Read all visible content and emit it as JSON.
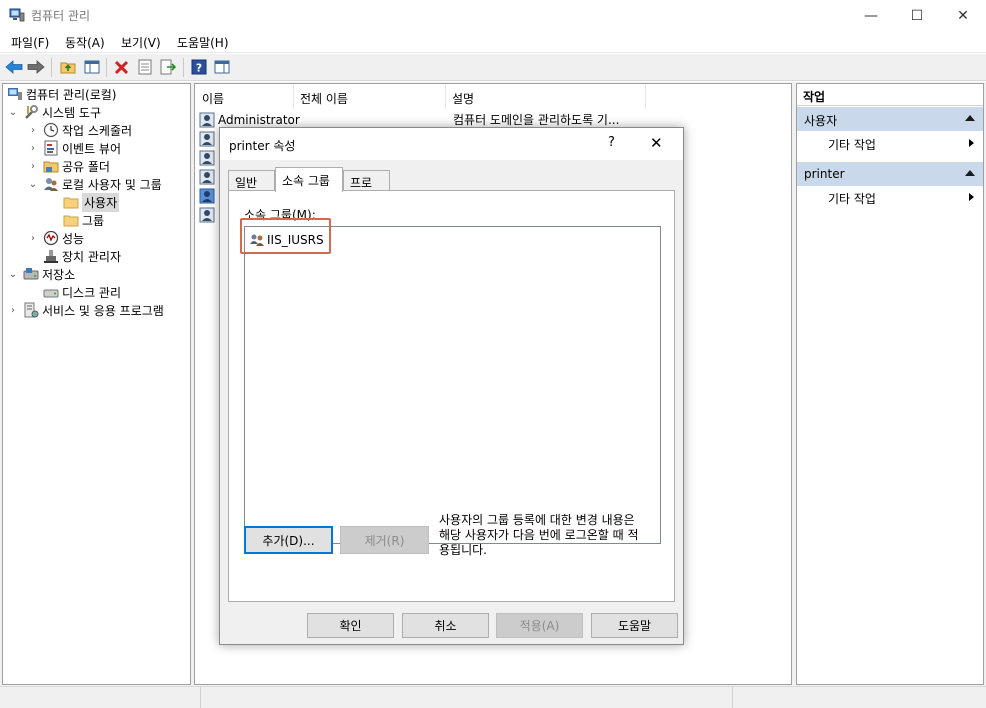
{
  "window": {
    "title": "컴퓨터 관리",
    "minimize_glyph": "—",
    "maximize_glyph": "☐",
    "close_glyph": "✕"
  },
  "menu": [
    "파일(F)",
    "동작(A)",
    "보기(V)",
    "도움말(H)"
  ],
  "toolbar_icons": [
    "back-icon",
    "forward-icon",
    "up-folder-icon",
    "show-hide-tree-icon",
    "delete-icon",
    "properties-icon",
    "export-icon",
    "help-icon",
    "action-pane-icon"
  ],
  "tree": {
    "root": "컴퓨터 관리(로컬)",
    "system_tools": "시스템 도구",
    "task_scheduler": "작업 스케줄러",
    "event_viewer": "이벤트 뷰어",
    "shared_folders": "공유 폴더",
    "local_users_groups": "로컬 사용자 및 그룹",
    "users": "사용자",
    "groups": "그룹",
    "performance": "성능",
    "device_manager": "장치 관리자",
    "storage": "저장소",
    "disk_management": "디스크 관리",
    "services_apps": "서비스 및 응용 프로그램"
  },
  "list": {
    "columns": [
      "이름",
      "전체 이름",
      "설명"
    ],
    "rows": [
      {
        "name": "Administrator",
        "full_name": "",
        "description": "컴퓨터 도메인을 관리하도록 기..."
      }
    ]
  },
  "actions": {
    "title": "작업",
    "sections": [
      {
        "label": "사용자",
        "item": "기타 작업"
      },
      {
        "label": "printer",
        "item": "기타 작업"
      }
    ]
  },
  "dialog": {
    "title": "printer 속성",
    "help_glyph": "?",
    "close_glyph": "✕",
    "tabs": [
      "일반",
      "소속 그룹",
      "프로필"
    ],
    "member_of_label": "소속 그룹(M):",
    "members": [
      "IIS_IUSRS"
    ],
    "add_button": "추가(D)...",
    "remove_button": "제거(R)",
    "note_line1": "사용자의 그룹 등록에 대한 변경 내용은",
    "note_line2": "해당 사용자가 다음 번에 로그온할 때 적",
    "note_line3": "용됩니다.",
    "ok": "확인",
    "cancel": "취소",
    "apply": "적용(A)",
    "help": "도움말"
  },
  "colors": {
    "action_section_bg": "#c9d8ea",
    "highlight_border": "#d36a50",
    "default_button_border": "#0078d7"
  }
}
